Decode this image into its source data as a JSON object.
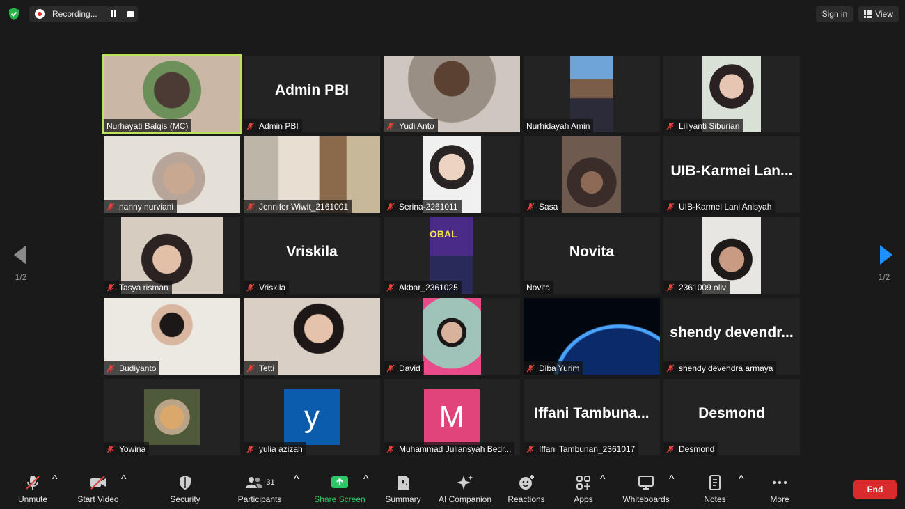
{
  "top": {
    "recording_label": "Recording...",
    "sign_in": "Sign in",
    "view": "View"
  },
  "pagination": {
    "left": "1/2",
    "right": "1/2"
  },
  "colors": {
    "active_border": "#b9e35a",
    "end_button": "#d92b2b",
    "share_green": "#2ec866",
    "yulia_avatar": "#0b5cad",
    "muhammad_avatar": "#e0447a"
  },
  "participants": [
    {
      "name": "Nurhayati Balqis (MC)",
      "muted": false,
      "active": true,
      "display": "video"
    },
    {
      "name": "Admin PBI",
      "muted": true,
      "display": "name",
      "big": "Admin PBI"
    },
    {
      "name": "Yudi Anto",
      "muted": true,
      "display": "video"
    },
    {
      "name": "Nurhidayah Amin",
      "muted": false,
      "display": "video"
    },
    {
      "name": "Liliyanti Siburian",
      "muted": true,
      "display": "video"
    },
    {
      "name": "nanny nurviani",
      "muted": true,
      "display": "video"
    },
    {
      "name": "Jennifer Wiwit_2161001",
      "muted": true,
      "display": "video"
    },
    {
      "name": "Serina-2261011",
      "muted": true,
      "display": "video"
    },
    {
      "name": "Sasa",
      "muted": true,
      "display": "video"
    },
    {
      "name": "UIB-Karmei Lani Anisyah",
      "muted": true,
      "display": "name",
      "big": "UIB-Karmei  Lan..."
    },
    {
      "name": "Tasya risman",
      "muted": true,
      "display": "video"
    },
    {
      "name": "Vriskila",
      "muted": true,
      "display": "name",
      "big": "Vriskila"
    },
    {
      "name": "Akbar_2361025",
      "muted": true,
      "display": "video",
      "poster_text": "OBAL"
    },
    {
      "name": "Novita",
      "muted": false,
      "display": "name",
      "big": "Novita"
    },
    {
      "name": "2361009 oliv",
      "muted": true,
      "display": "video"
    },
    {
      "name": "Budiyanto",
      "muted": true,
      "display": "video"
    },
    {
      "name": "Tetti",
      "muted": true,
      "display": "video"
    },
    {
      "name": "David",
      "muted": true,
      "display": "video"
    },
    {
      "name": "Diba Yurim",
      "muted": true,
      "display": "video"
    },
    {
      "name": "shendy devendra armaya",
      "muted": true,
      "display": "name",
      "big": "shendy  devendr..."
    },
    {
      "name": "Yowina",
      "muted": true,
      "display": "video"
    },
    {
      "name": "yulia azizah",
      "muted": true,
      "display": "avatar",
      "letter": "y"
    },
    {
      "name": "Muhammad Juliansyah Bedr...",
      "muted": true,
      "display": "avatar",
      "letter": "M"
    },
    {
      "name": "Iffani Tambunan_2361017",
      "muted": true,
      "display": "name",
      "big": "Iffani  Tambuna..."
    },
    {
      "name": "Desmond",
      "muted": true,
      "display": "name",
      "big": "Desmond"
    }
  ],
  "toolbar": {
    "unmute": "Unmute",
    "start_video": "Start Video",
    "security": "Security",
    "participants": "Participants",
    "participant_count": "31",
    "share_screen": "Share Screen",
    "summary": "Summary",
    "ai_companion": "AI Companion",
    "reactions": "Reactions",
    "apps": "Apps",
    "whiteboards": "Whiteboards",
    "notes": "Notes",
    "more": "More",
    "end": "End"
  }
}
